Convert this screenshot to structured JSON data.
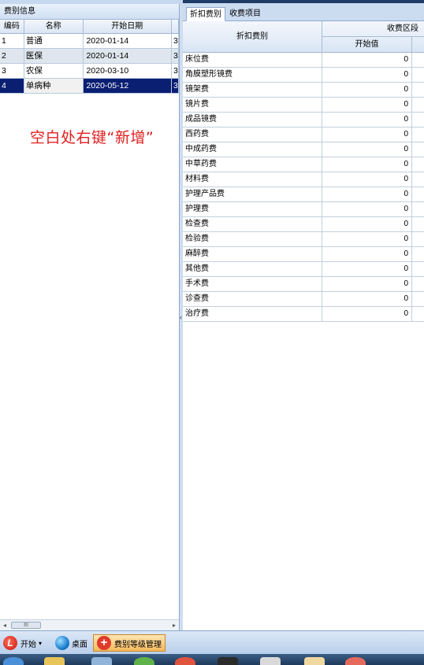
{
  "left_panel": {
    "title": "费别信息",
    "columns": [
      "编码",
      "名称",
      "开始日期"
    ],
    "rows": [
      {
        "code": "1",
        "name": "普通",
        "date": "2020-01-14",
        "extra": "3"
      },
      {
        "code": "2",
        "name": "医保",
        "date": "2020-01-14",
        "extra": "3"
      },
      {
        "code": "3",
        "name": "农保",
        "date": "2020-03-10",
        "extra": "3"
      },
      {
        "code": "4",
        "name": "单病种",
        "date": "2020-05-12",
        "extra": "3"
      }
    ],
    "hint": "空白处右键“新增”",
    "scroll_thumb": "III"
  },
  "right_panel": {
    "tabs": [
      "折扣费别",
      "收费项目"
    ],
    "header": {
      "category": "折扣费别",
      "group": "收费区段",
      "start": "开始值"
    },
    "rows": [
      {
        "cat": "床位费",
        "val": "0"
      },
      {
        "cat": "角膜塑形镜费",
        "val": "0"
      },
      {
        "cat": "镜架费",
        "val": "0"
      },
      {
        "cat": "镜片费",
        "val": "0"
      },
      {
        "cat": "成品镜费",
        "val": "0"
      },
      {
        "cat": "西药费",
        "val": "0"
      },
      {
        "cat": "中成药费",
        "val": "0"
      },
      {
        "cat": "中草药费",
        "val": "0"
      },
      {
        "cat": "材料费",
        "val": "0"
      },
      {
        "cat": "护理产品费",
        "val": "0"
      },
      {
        "cat": "护理费",
        "val": "0"
      },
      {
        "cat": "检查费",
        "val": "0"
      },
      {
        "cat": "检验费",
        "val": "0"
      },
      {
        "cat": "麻醉费",
        "val": "0"
      },
      {
        "cat": "其他费",
        "val": "0"
      },
      {
        "cat": "手术费",
        "val": "0"
      },
      {
        "cat": "诊查费",
        "val": "0"
      },
      {
        "cat": "治疗费",
        "val": "0"
      }
    ]
  },
  "taskbar": {
    "start_label": "开始",
    "start_arrow": "▾",
    "desktop_label": "桌面",
    "active_task_label": "费别等级管理"
  },
  "colors": {
    "selection": "#0a1e72",
    "hint_red": "#e02020",
    "header_blue": "#d9e5f4"
  }
}
